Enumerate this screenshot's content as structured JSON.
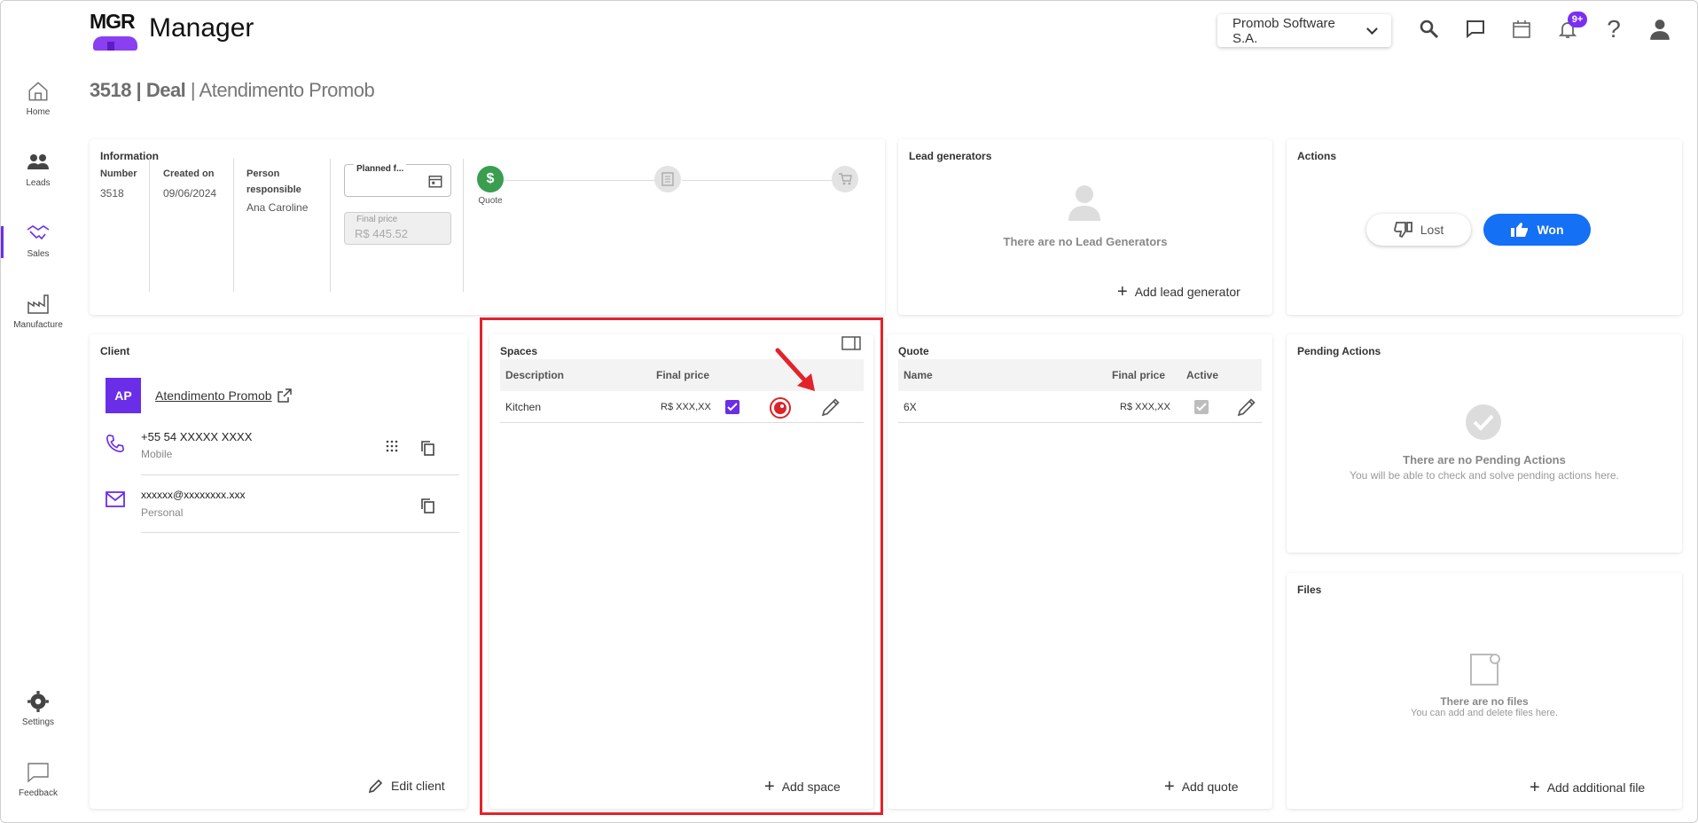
{
  "header": {
    "logo_text": "MGR",
    "app_title": "Manager",
    "company": "Promob Software S.A.",
    "notifications_badge": "9+"
  },
  "sidebar": {
    "items": [
      {
        "label": "Home",
        "icon": "home-icon"
      },
      {
        "label": "Leads",
        "icon": "people-icon"
      },
      {
        "label": "Sales",
        "icon": "handshake-icon"
      },
      {
        "label": "Manufacture",
        "icon": "factory-icon"
      },
      {
        "label": "Settings",
        "icon": "gear-icon"
      },
      {
        "label": "Feedback",
        "icon": "feedback-icon"
      }
    ],
    "active": "Sales"
  },
  "breadcrumb": {
    "id_deal": "3518 | Deal",
    "separator": " | ",
    "name": "Atendimento Promob"
  },
  "information": {
    "title": "Information",
    "number_label": "Number",
    "number_value": "3518",
    "created_label": "Created on",
    "created_value": "09/06/2024",
    "person_label": "Person responsible",
    "person_value": "Ana Caroline",
    "planned_label": "Planned f...",
    "final_price_label": "Final price",
    "final_price_value": "R$ 445.52",
    "stage_label": "Quote"
  },
  "lead_generators": {
    "title": "Lead generators",
    "empty": "There are no Lead Generators",
    "add": "Add lead generator"
  },
  "actions": {
    "title": "Actions",
    "lost": "Lost",
    "won": "Won"
  },
  "client": {
    "title": "Client",
    "initials": "AP",
    "name": "Atendimento Promob",
    "phone": "+55 54 XXXXX XXXX",
    "phone_type": "Mobile",
    "email": "xxxxxx@xxxxxxxx.xxx",
    "email_type": "Personal",
    "edit": "Edit client"
  },
  "spaces": {
    "title": "Spaces",
    "col_description": "Description",
    "col_final_price": "Final price",
    "rows": [
      {
        "description": "Kitchen",
        "price": "R$ XXX,XX"
      }
    ],
    "add": "Add space"
  },
  "quote": {
    "title": "Quote",
    "col_name": "Name",
    "col_final_price": "Final price",
    "col_active": "Active",
    "rows": [
      {
        "name": "6X",
        "price": "R$ XXX,XX"
      }
    ],
    "add": "Add quote"
  },
  "pending": {
    "title": "Pending Actions",
    "empty": "There are no Pending Actions",
    "sub": "You will be able to check and solve pending actions here."
  },
  "files": {
    "title": "Files",
    "empty": "There are no files",
    "sub": "You can add and delete files here.",
    "add": "Add additional file"
  },
  "colors": {
    "accent": "#6a2ee8",
    "won": "#1470f5",
    "quote_step": "#3a9d4f",
    "highlight": "#e2232a"
  }
}
